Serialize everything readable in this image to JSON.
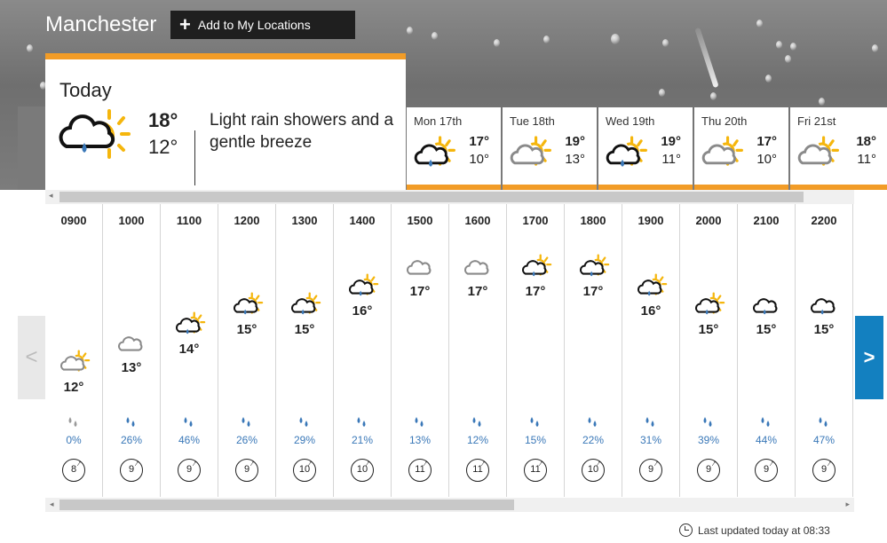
{
  "header": {
    "city": "Manchester",
    "add_location_label": "Add to My Locations"
  },
  "today": {
    "title": "Today",
    "max": "18°",
    "min": "12°",
    "description": "Light rain showers and a gentle breeze",
    "icon": "light-rain-sun-icon"
  },
  "days": [
    {
      "name": "Mon 17th",
      "max": "17°",
      "min": "10°",
      "icon": "light-rain-sun-icon"
    },
    {
      "name": "Tue 18th",
      "max": "19°",
      "min": "13°",
      "icon": "cloud-sun-icon"
    },
    {
      "name": "Wed 19th",
      "max": "19°",
      "min": "11°",
      "icon": "light-rain-sun-icon"
    },
    {
      "name": "Thu 20th",
      "max": "17°",
      "min": "10°",
      "icon": "cloud-sun-icon"
    },
    {
      "name": "Fri 21st",
      "max": "18°",
      "min": "11°",
      "icon": "cloud-sun-icon"
    }
  ],
  "hours": [
    {
      "time": "0900",
      "temp": "12°",
      "icon": "cloud-sun-icon",
      "rain": "0%",
      "wind": "8"
    },
    {
      "time": "1000",
      "temp": "13°",
      "icon": "cloud-icon",
      "rain": "26%",
      "wind": "9"
    },
    {
      "time": "1100",
      "temp": "14°",
      "icon": "light-rain-sun-icon",
      "rain": "46%",
      "wind": "9"
    },
    {
      "time": "1200",
      "temp": "15°",
      "icon": "light-rain-sun-icon",
      "rain": "26%",
      "wind": "9"
    },
    {
      "time": "1300",
      "temp": "15°",
      "icon": "light-rain-sun-icon",
      "rain": "29%",
      "wind": "10"
    },
    {
      "time": "1400",
      "temp": "16°",
      "icon": "light-rain-sun-icon",
      "rain": "21%",
      "wind": "10"
    },
    {
      "time": "1500",
      "temp": "17°",
      "icon": "cloud-icon",
      "rain": "13%",
      "wind": "11"
    },
    {
      "time": "1600",
      "temp": "17°",
      "icon": "cloud-icon",
      "rain": "12%",
      "wind": "11"
    },
    {
      "time": "1700",
      "temp": "17°",
      "icon": "light-rain-sun-icon",
      "rain": "15%",
      "wind": "11"
    },
    {
      "time": "1800",
      "temp": "17°",
      "icon": "light-rain-sun-icon",
      "rain": "22%",
      "wind": "10"
    },
    {
      "time": "1900",
      "temp": "16°",
      "icon": "light-rain-sun-icon",
      "rain": "31%",
      "wind": "9"
    },
    {
      "time": "2000",
      "temp": "15°",
      "icon": "light-rain-sun-icon",
      "rain": "39%",
      "wind": "9"
    },
    {
      "time": "2100",
      "temp": "15°",
      "icon": "light-rain-icon",
      "rain": "44%",
      "wind": "9"
    },
    {
      "time": "2200",
      "temp": "15°",
      "icon": "light-rain-icon",
      "rain": "47%",
      "wind": "9"
    }
  ],
  "footer": {
    "last_updated": "Last updated today at 08:33"
  },
  "colors": {
    "accent": "#f29c27",
    "nav_blue": "#1380c0",
    "rain_blue": "#3a78b8",
    "sun": "#f5b60d"
  }
}
